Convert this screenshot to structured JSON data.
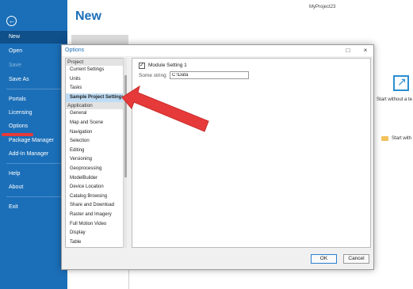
{
  "window_title": "MyProject23",
  "backstage": {
    "back_icon": "back-arrow-icon",
    "items": [
      {
        "label": "New"
      },
      {
        "label": "Open"
      },
      {
        "label": "Save"
      },
      {
        "label": "Save As"
      },
      {
        "label": "Portals"
      },
      {
        "label": "Licensing"
      },
      {
        "label": "Options"
      },
      {
        "label": "Package Manager"
      },
      {
        "label": "Add-In Manager"
      },
      {
        "label": "Help"
      },
      {
        "label": "About"
      },
      {
        "label": "Exit"
      }
    ],
    "accent": "#1b6fb8",
    "active_item": "New",
    "disabled_item": "Save"
  },
  "page_title": "New",
  "start_options": [
    {
      "label": "Start without a te",
      "icon": "diagonal-arrow-icon"
    },
    {
      "label": "Start with",
      "icon": "folder-icon"
    }
  ],
  "dialog": {
    "title": "Options",
    "controls": {
      "maximize": "□",
      "close": "×"
    },
    "tree": {
      "groups": [
        {
          "label": "Project",
          "items": [
            "Current Settings",
            "Units",
            "Tasks",
            "Sample Project Settings"
          ]
        },
        {
          "label": "Application",
          "items": [
            "General",
            "Map and Scene",
            "Navigation",
            "Selection",
            "Editing",
            "Versioning",
            "Geoprocessing",
            "ModelBuilder",
            "Device Location",
            "Catalog Browsing",
            "Share and Download",
            "Raster and Imagery",
            "Full Motion Video",
            "Display",
            "Table"
          ]
        }
      ],
      "selected": "Sample Project Settings"
    },
    "settings": {
      "checkbox_label": "Module Setting 1",
      "checkbox_checked": true,
      "checkbox_mark": "✓",
      "string_label": "Some string",
      "string_value": "C:\\Data"
    },
    "buttons": {
      "ok": "OK",
      "cancel": "Cancel"
    }
  },
  "annotation_color": "#e63a3a"
}
